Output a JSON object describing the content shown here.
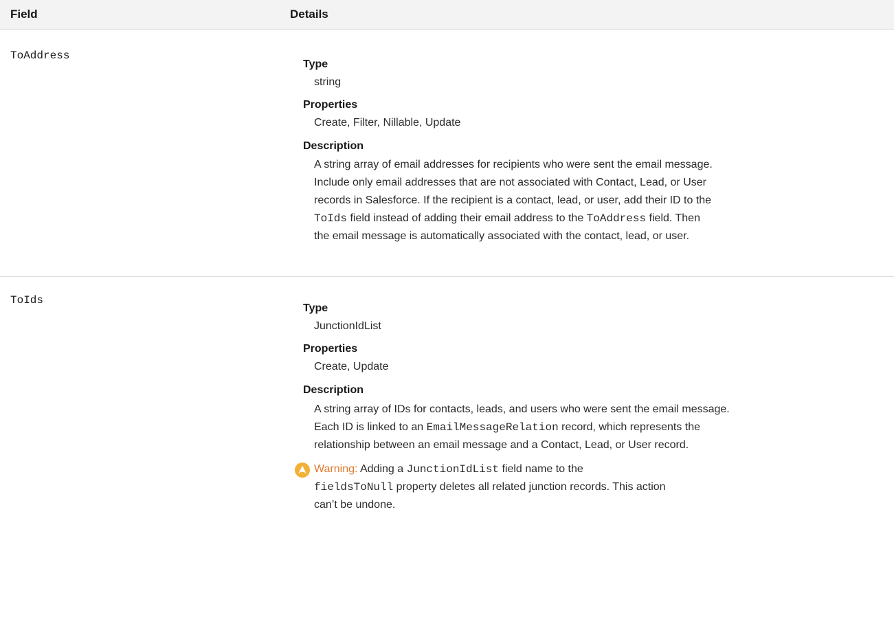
{
  "header": {
    "field": "Field",
    "details": "Details"
  },
  "rows": [
    {
      "name": "ToAddress",
      "type_label": "Type",
      "type_value": "string",
      "properties_label": "Properties",
      "properties_value": "Create, Filter, Nillable, Update",
      "description_label": "Description",
      "description": {
        "line1": "A string array of email addresses for recipients who were sent the email message.",
        "line2": "Include only email addresses that are not associated with Contact, Lead, or User",
        "line3": "records in Salesforce. If the recipient is a contact, lead, or user, add their ID to the",
        "line4_code1": "ToIds",
        "line4_mid": " field instead of adding their email address to the ",
        "line4_code2": "ToAddress",
        "line4_end": " field. Then",
        "line5": "the email message is automatically associated with the contact, lead, or user."
      }
    },
    {
      "name": "ToIds",
      "type_label": "Type",
      "type_value": "JunctionIdList",
      "properties_label": "Properties",
      "properties_value": "Create, Update",
      "description_label": "Description",
      "description": {
        "line1": "A string array of IDs for contacts, leads, and users who were sent the email message.",
        "line2_start": "Each ID is linked to an ",
        "line2_code": "EmailMessageRelation",
        "line2_end": " record, which represents the",
        "line3": "relationship between an email message and a Contact, Lead, or User record."
      },
      "warning": {
        "title": "Warning:",
        "line1_start": " Adding a ",
        "line1_code": "JunctionIdList",
        "line1_end": " field name to the",
        "line2_code": "fieldsToNull",
        "line2_end": " property deletes all related junction records. This action",
        "line3": "can’t be undone."
      }
    }
  ],
  "colors": {
    "header_bg": "#f3f3f3",
    "warning_accent": "#e07a2e",
    "warning_icon": "#f2b134"
  }
}
